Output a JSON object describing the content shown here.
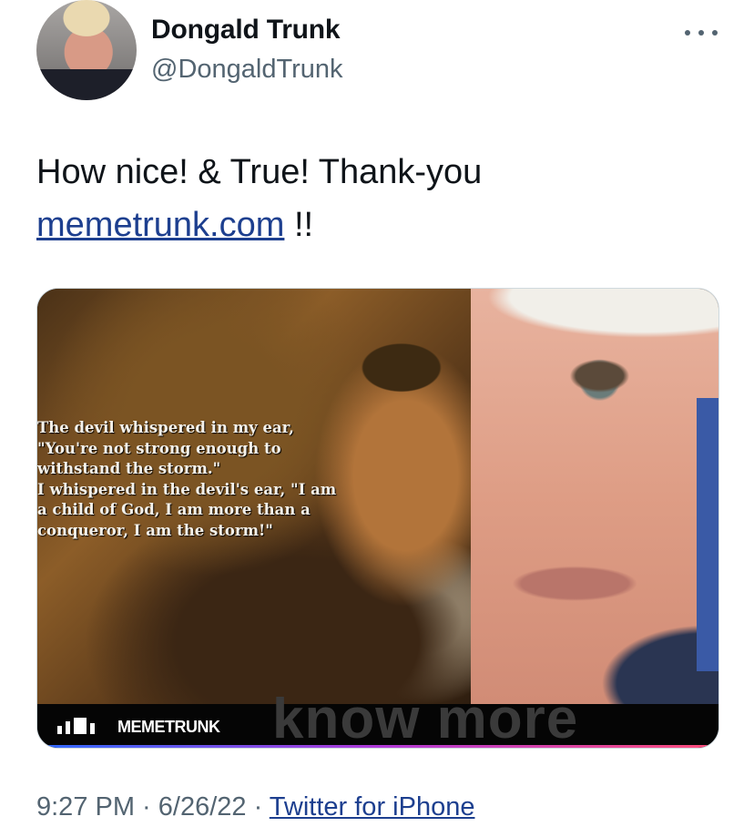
{
  "author": {
    "display_name": "Dongald Trunk",
    "handle": "@DongaldTrunk"
  },
  "menu": {
    "icon": "more-horizontal-icon"
  },
  "tweet": {
    "text_before_link": "How nice! & True! Thank-you",
    "link_text": "memetrunk.com",
    "text_after_link": " !!"
  },
  "media": {
    "quote_lines": [
      "The devil whispered in my ear,",
      "\"You're not strong enough to",
      "withstand the storm.\"",
      "I whispered in the devil's ear, \"I am",
      "a child of God, I am more than a",
      "conqueror, I am the storm!\""
    ],
    "brand_name": "MEMETRUNK",
    "cta": "know more"
  },
  "meta": {
    "time": "9:27 PM",
    "separator": " · ",
    "date": "6/26/22",
    "source": "Twitter for iPhone"
  }
}
